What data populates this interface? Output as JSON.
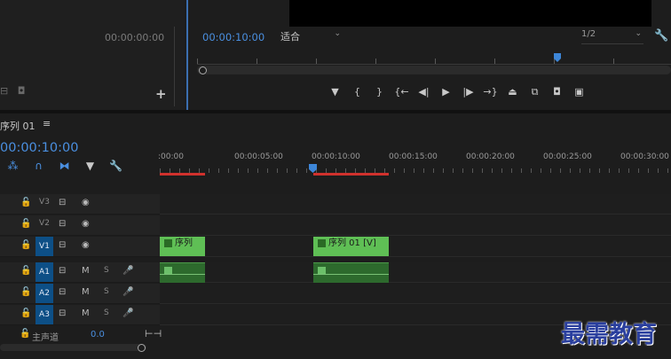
{
  "source_monitor": {
    "timecode": "00:00:00:00"
  },
  "program_monitor": {
    "timecode": "00:00:10:00",
    "fit_label": "适合",
    "resolution_label": "1/2"
  },
  "transport": {
    "buttons": [
      {
        "name": "add-marker-button",
        "glyph": "▼"
      },
      {
        "name": "mark-in-button",
        "glyph": "{"
      },
      {
        "name": "mark-out-button",
        "glyph": "}"
      },
      {
        "name": "go-to-in-button",
        "glyph": "{←"
      },
      {
        "name": "step-back-button",
        "glyph": "◀|"
      },
      {
        "name": "play-button",
        "glyph": "▶"
      },
      {
        "name": "step-forward-button",
        "glyph": "|▶"
      },
      {
        "name": "go-to-out-button",
        "glyph": "→}"
      },
      {
        "name": "lift-button",
        "glyph": "⏏"
      },
      {
        "name": "extract-button",
        "glyph": "⧉"
      },
      {
        "name": "export-frame-button",
        "glyph": "◘"
      },
      {
        "name": "comparison-view-button",
        "glyph": "▣"
      }
    ]
  },
  "timeline": {
    "sequence_tab": "序列 01",
    "timecode": "00:00:10:00",
    "ruler_labels": [
      ":00:00",
      "00:00:05:00",
      "00:00:10:00",
      "00:00:15:00",
      "00:00:20:00",
      "00:00:25:00",
      "00:00:30:00"
    ],
    "video_tracks": [
      {
        "name": "V3",
        "active": false
      },
      {
        "name": "V2",
        "active": false
      },
      {
        "name": "V1",
        "active": true
      }
    ],
    "audio_tracks": [
      {
        "name": "A1",
        "mute": "M",
        "solo": "S"
      },
      {
        "name": "A2",
        "mute": "M",
        "solo": "S"
      },
      {
        "name": "A3",
        "mute": "M",
        "solo": "S"
      }
    ],
    "clips": {
      "v1_clip1_label": "序列",
      "v1_clip2_label": "序列 01 [V]"
    },
    "master": {
      "label": "主声道",
      "value": "0.0"
    }
  },
  "watermark": {
    "text": "最需教育"
  },
  "colors": {
    "accent": "#4a8fe0",
    "clip_video": "#5fbf55",
    "clip_audio": "#2d6a2d",
    "work_area": "#d0312d",
    "active_track": "#0d4f86"
  }
}
